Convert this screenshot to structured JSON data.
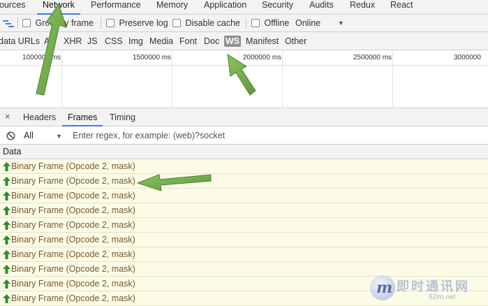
{
  "tabs": [
    {
      "label": "Sources",
      "shown": "ources",
      "active": false
    },
    {
      "label": "Network",
      "active": true
    },
    {
      "label": "Performance",
      "active": false
    },
    {
      "label": "Memory",
      "active": false
    },
    {
      "label": "Application",
      "active": false
    },
    {
      "label": "Security",
      "active": false
    },
    {
      "label": "Audits",
      "active": false
    },
    {
      "label": "Redux",
      "active": false
    },
    {
      "label": "React",
      "active": false
    }
  ],
  "toolbar": {
    "group_by_frame": "Group by frame",
    "group_by_frame_shown_left": "Grou",
    "group_by_frame_shown_right": "y frame",
    "preserve_log": "Preserve log",
    "disable_cache": "Disable cache",
    "offline": "Offline",
    "throttle": "Online"
  },
  "filters": [
    {
      "label": "data URLs",
      "active": false
    },
    {
      "label": "All",
      "shown": "Al",
      "active": false
    },
    {
      "label": "XHR",
      "active": false
    },
    {
      "label": "JS",
      "active": false
    },
    {
      "label": "CSS",
      "active": false
    },
    {
      "label": "Img",
      "active": false
    },
    {
      "label": "Media",
      "active": false
    },
    {
      "label": "Font",
      "active": false
    },
    {
      "label": "Doc",
      "active": false
    },
    {
      "label": "WS",
      "active": true
    },
    {
      "label": "Manifest",
      "active": false
    },
    {
      "label": "Other",
      "active": false
    }
  ],
  "timeline": {
    "ticks": [
      "1000000 ms",
      "1500000 ms",
      "2000000 ms",
      "2500000 ms",
      "3000000"
    ]
  },
  "detail_tabs": [
    {
      "label": "Headers",
      "active": false
    },
    {
      "label": "Frames",
      "active": true
    },
    {
      "label": "Timing",
      "active": false
    }
  ],
  "frame_filter": {
    "type": "All",
    "placeholder": "Enter regex, for example: (web)?socket"
  },
  "data_header": "Data",
  "frames": [
    "Binary Frame (Opcode 2, mask)",
    "Binary Frame (Opcode 2, mask)",
    "Binary Frame (Opcode 2, mask)",
    "Binary Frame (Opcode 2, mask)",
    "Binary Frame (Opcode 2, mask)",
    "Binary Frame (Opcode 2, mask)",
    "Binary Frame (Opcode 2, mask)",
    "Binary Frame (Opcode 2, mask)",
    "Binary Frame (Opcode 2, mask)",
    "Binary Frame (Opcode 2, mask)"
  ],
  "watermark": {
    "logo_letter": "m",
    "title": "即时通讯网",
    "url": "52im.net"
  },
  "colors": {
    "accent": "#3c7ee8",
    "frame_bg": "#fbfbe6",
    "frame_text": "#7a5a2a",
    "upload_arrow": "#2e8b2e",
    "annotation_arrow": "#6aa84f"
  }
}
